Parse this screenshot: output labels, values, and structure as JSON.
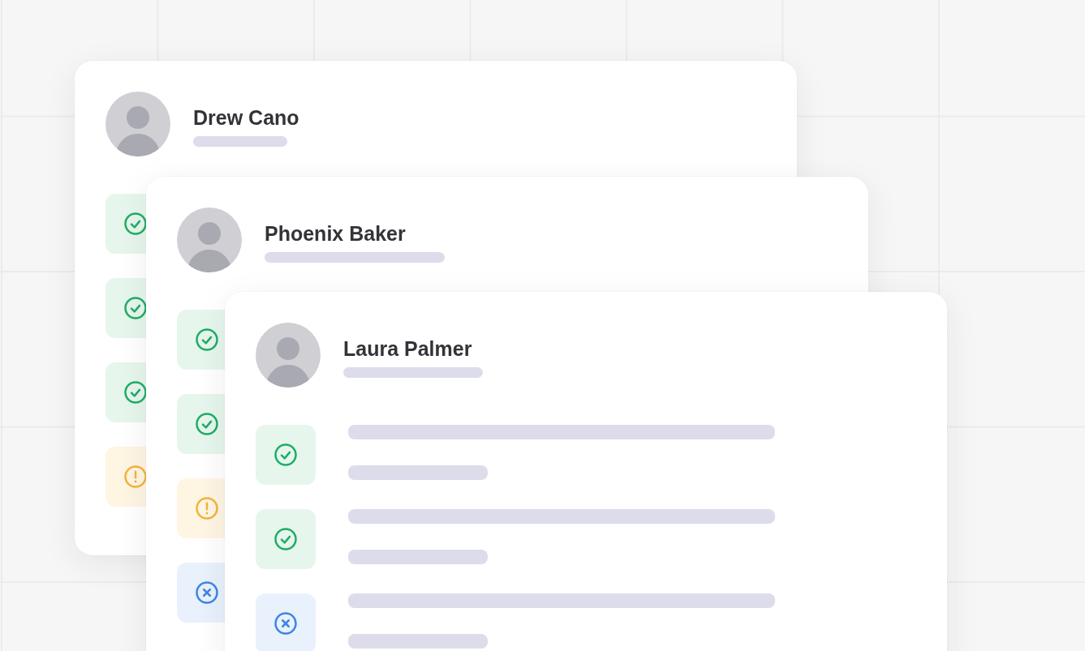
{
  "cards": [
    {
      "name": "Drew Cano",
      "items": [
        {
          "kind": "success"
        },
        {
          "kind": "success"
        },
        {
          "kind": "success"
        },
        {
          "kind": "warning"
        }
      ]
    },
    {
      "name": "Phoenix Baker",
      "items": [
        {
          "kind": "success"
        },
        {
          "kind": "success"
        },
        {
          "kind": "warning"
        },
        {
          "kind": "error"
        }
      ]
    },
    {
      "name": "Laura Palmer",
      "items": [
        {
          "kind": "success"
        },
        {
          "kind": "success"
        },
        {
          "kind": "error"
        }
      ]
    }
  ]
}
